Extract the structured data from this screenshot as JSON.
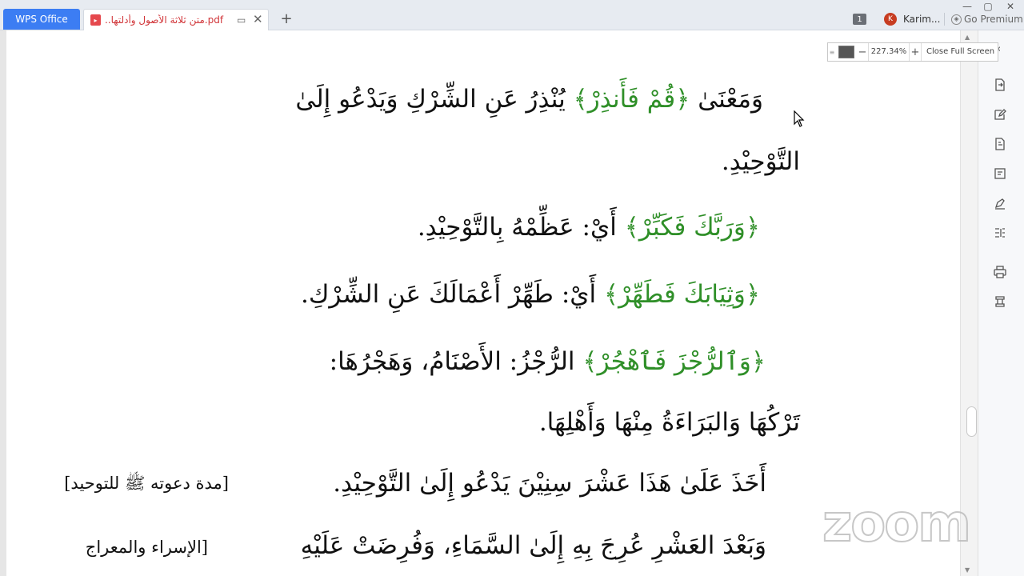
{
  "titlebar": {
    "app_tab": "WPS Office",
    "doc_tab": "..متن ثلاثة الأصول وأدلتها.pdf",
    "notification_count": "1",
    "user_initial": "K",
    "user_name": "Karim...",
    "premium": "Go Premium"
  },
  "zoom_widget": {
    "value": "227.34%",
    "close_label": "Close Full Screen"
  },
  "document": {
    "lines": [
      {
        "pre": "وَمَعْنَىٰ ",
        "quran": "﴿قُمْ فَأَنذِرْ﴾",
        "post": " يُنْذِرُ عَنِ الشِّرْكِ وَيَدْعُو إِلَىٰ"
      },
      {
        "pre": "التَّوْحِيْدِ.",
        "quran": "",
        "post": ""
      },
      {
        "pre": "",
        "quran": "﴿وَرَبَّكَ فَكَبِّرْ﴾",
        "post": " أَيْ: عَظِّمْهُ بِالتَّوْحِيْدِ."
      },
      {
        "pre": "",
        "quran": "﴿وَثِيَابَكَ فَطَهِّرْ﴾",
        "post": " أَيْ: طَهِّرْ أَعْمَالَكَ عَنِ الشِّرْكِ."
      },
      {
        "pre": "",
        "quran": "﴿وَٱلرُّجْزَ فَٱهْجُرْ﴾",
        "post": " الرُّجْزُ: الأَصْنَامُ، وَهَجْرُهَا:"
      },
      {
        "pre": "تَرْكُهَا وَالبَرَاءَةُ مِنْهَا وَأَهْلِهَا.",
        "quran": "",
        "post": ""
      },
      {
        "pre": "أَخَذَ عَلَىٰ هَذَا عَشْرَ سِنِيْنَ يَدْعُو إِلَىٰ التَّوْحِيْدِ.",
        "quran": "",
        "post": ""
      },
      {
        "pre": "وَبَعْدَ العَشْرِ عُرِجَ بِهِ إِلَىٰ السَّمَاءِ، وَفُرِضَتْ عَلَيْهِ",
        "quran": "",
        "post": ""
      }
    ],
    "notes": [
      "[مدة دعوته ﷺ للتوحيد]",
      "[الإسراء والمعراج"
    ]
  },
  "watermark": "zoom",
  "colors": {
    "quran_text": "#2f8f28",
    "app_tab_bg": "#3c7df3",
    "pdf_title": "#d13438"
  }
}
